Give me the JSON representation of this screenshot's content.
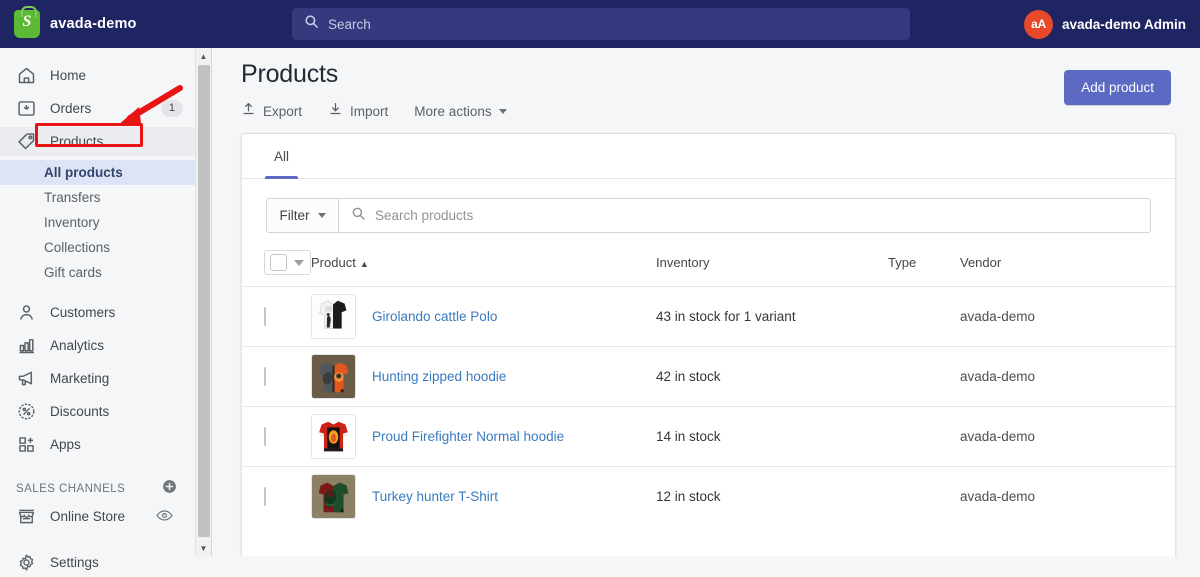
{
  "topbar": {
    "logo_icon": "shopify-bag-icon",
    "store_name": "avada-demo",
    "search": {
      "icon": "search-icon",
      "placeholder": "Search"
    },
    "user": {
      "avatar_initials": "aA",
      "name": "avada-demo Admin",
      "avatar_color": "#e8492a"
    }
  },
  "sidebar": {
    "items": [
      {
        "label": "Home",
        "icon": "home-icon"
      },
      {
        "label": "Orders",
        "icon": "orders-inbox-icon",
        "badge": "1"
      },
      {
        "label": "Products",
        "icon": "products-tag-icon",
        "active": true
      },
      {
        "label": "Customers",
        "icon": "customer-person-icon"
      },
      {
        "label": "Analytics",
        "icon": "analytics-bars-icon"
      },
      {
        "label": "Marketing",
        "icon": "marketing-megaphone-icon"
      },
      {
        "label": "Discounts",
        "icon": "discounts-percent-icon"
      },
      {
        "label": "Apps",
        "icon": "apps-squares-icon"
      }
    ],
    "product_subitems": [
      {
        "label": "All products",
        "selected": true
      },
      {
        "label": "Transfers",
        "selected": false
      },
      {
        "label": "Inventory",
        "selected": false
      },
      {
        "label": "Collections",
        "selected": false
      },
      {
        "label": "Gift cards",
        "selected": false
      }
    ],
    "sales_channels": {
      "title": "SALES CHANNELS",
      "add_icon": "plus-circle-icon",
      "items": [
        {
          "label": "Online Store",
          "icon": "online-store-icon",
          "trailing_icon": "eye-icon"
        }
      ]
    },
    "settings": {
      "label": "Settings",
      "icon": "gear-icon"
    },
    "scrollbar": {
      "up_icon": "scroll-up-arrow-icon",
      "down_icon": "scroll-down-arrow-icon"
    }
  },
  "main": {
    "page_title": "Products",
    "actions": [
      {
        "label": "Export",
        "icon": "export-up-arrow-icon"
      },
      {
        "label": "Import",
        "icon": "import-down-arrow-icon"
      },
      {
        "label": "More actions",
        "icon": "chevron-down-icon"
      }
    ],
    "add_product_label": "Add product",
    "add_product_color": "#5c6ac4",
    "tabs": [
      {
        "label": "All",
        "active": true
      }
    ],
    "filter": {
      "label": "Filter",
      "icon": "chevron-down-icon"
    },
    "search": {
      "icon": "search-icon",
      "placeholder": "Search products"
    },
    "table": {
      "headers": {
        "select_all": "",
        "product": "Product",
        "product_sort": "▲",
        "inventory": "Inventory",
        "type": "Type",
        "vendor": "Vendor"
      },
      "rows": [
        {
          "name": "Girolando cattle Polo",
          "inventory": "43 in stock for 1 variant",
          "type": "",
          "vendor": "avada-demo",
          "thumb": "polo-black-white"
        },
        {
          "name": "Hunting zipped hoodie",
          "inventory": "42 in stock",
          "type": "",
          "vendor": "avada-demo",
          "thumb": "hoodie-orange-gray"
        },
        {
          "name": "Proud Firefighter Normal hoodie",
          "inventory": "14 in stock",
          "type": "",
          "vendor": "avada-demo",
          "thumb": "hoodie-red-flame"
        },
        {
          "name": "Turkey hunter T-Shirt",
          "inventory": "12 in stock",
          "type": "",
          "vendor": "avada-demo",
          "thumb": "tshirt-dark-red-green"
        }
      ]
    }
  },
  "annotations": {
    "highlight_color": "#e81414",
    "highlight_target": "Products",
    "arrow": "pointer-arrow-to-products"
  }
}
